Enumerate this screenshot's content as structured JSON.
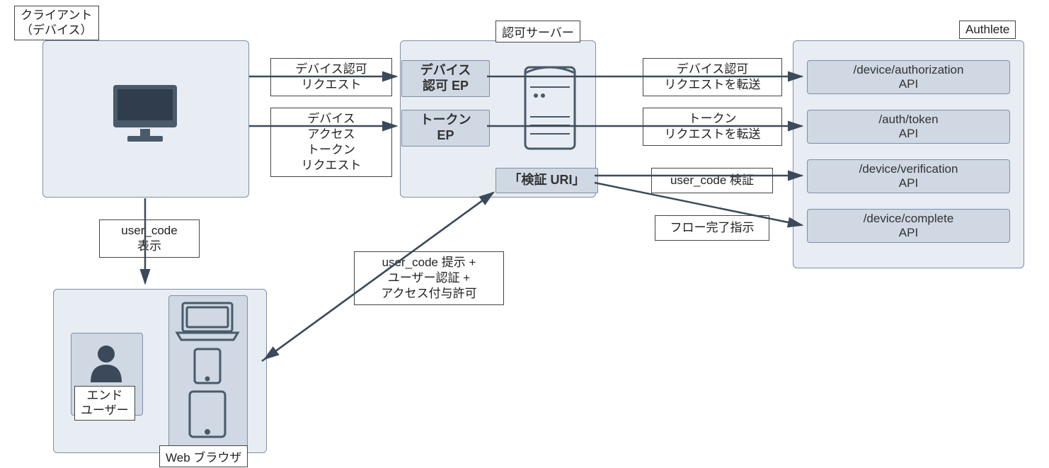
{
  "titles": {
    "client": "クライアント\n（デバイス）",
    "authServer": "認可サーバー",
    "authlete": "Authlete",
    "endUser": "エンド\nユーザー",
    "webBrowser": "Web ブラウザ"
  },
  "endpoints": {
    "deviceAuthEP": "デバイス\n認可 EP",
    "tokenEP": "トークン\nEP",
    "verificationURI": "「検証 URI」"
  },
  "apis": {
    "deviceAuthorization": "/device/authorization\nAPI",
    "authToken": "/auth/token\nAPI",
    "deviceVerification": "/device/verification\nAPI",
    "deviceComplete": "/device/complete\nAPI"
  },
  "flows": {
    "deviceAuthRequest": "デバイス認可\nリクエスト",
    "deviceAccessTokenRequest": "デバイス\nアクセス\nトークン\nリクエスト",
    "forwardDeviceAuthRequest": "デバイス認可\nリクエストを転送",
    "forwardTokenRequest": "トークン\nリクエストを転送",
    "userCodeVerification": "user_code 検証",
    "flowCompleteInstruction": "フロー完了指示",
    "userCodeDisplay": "user_code\n表示",
    "userCodePresentAuth": "user_code 提示 +\nユーザー認証 +\nアクセス付与許可"
  }
}
